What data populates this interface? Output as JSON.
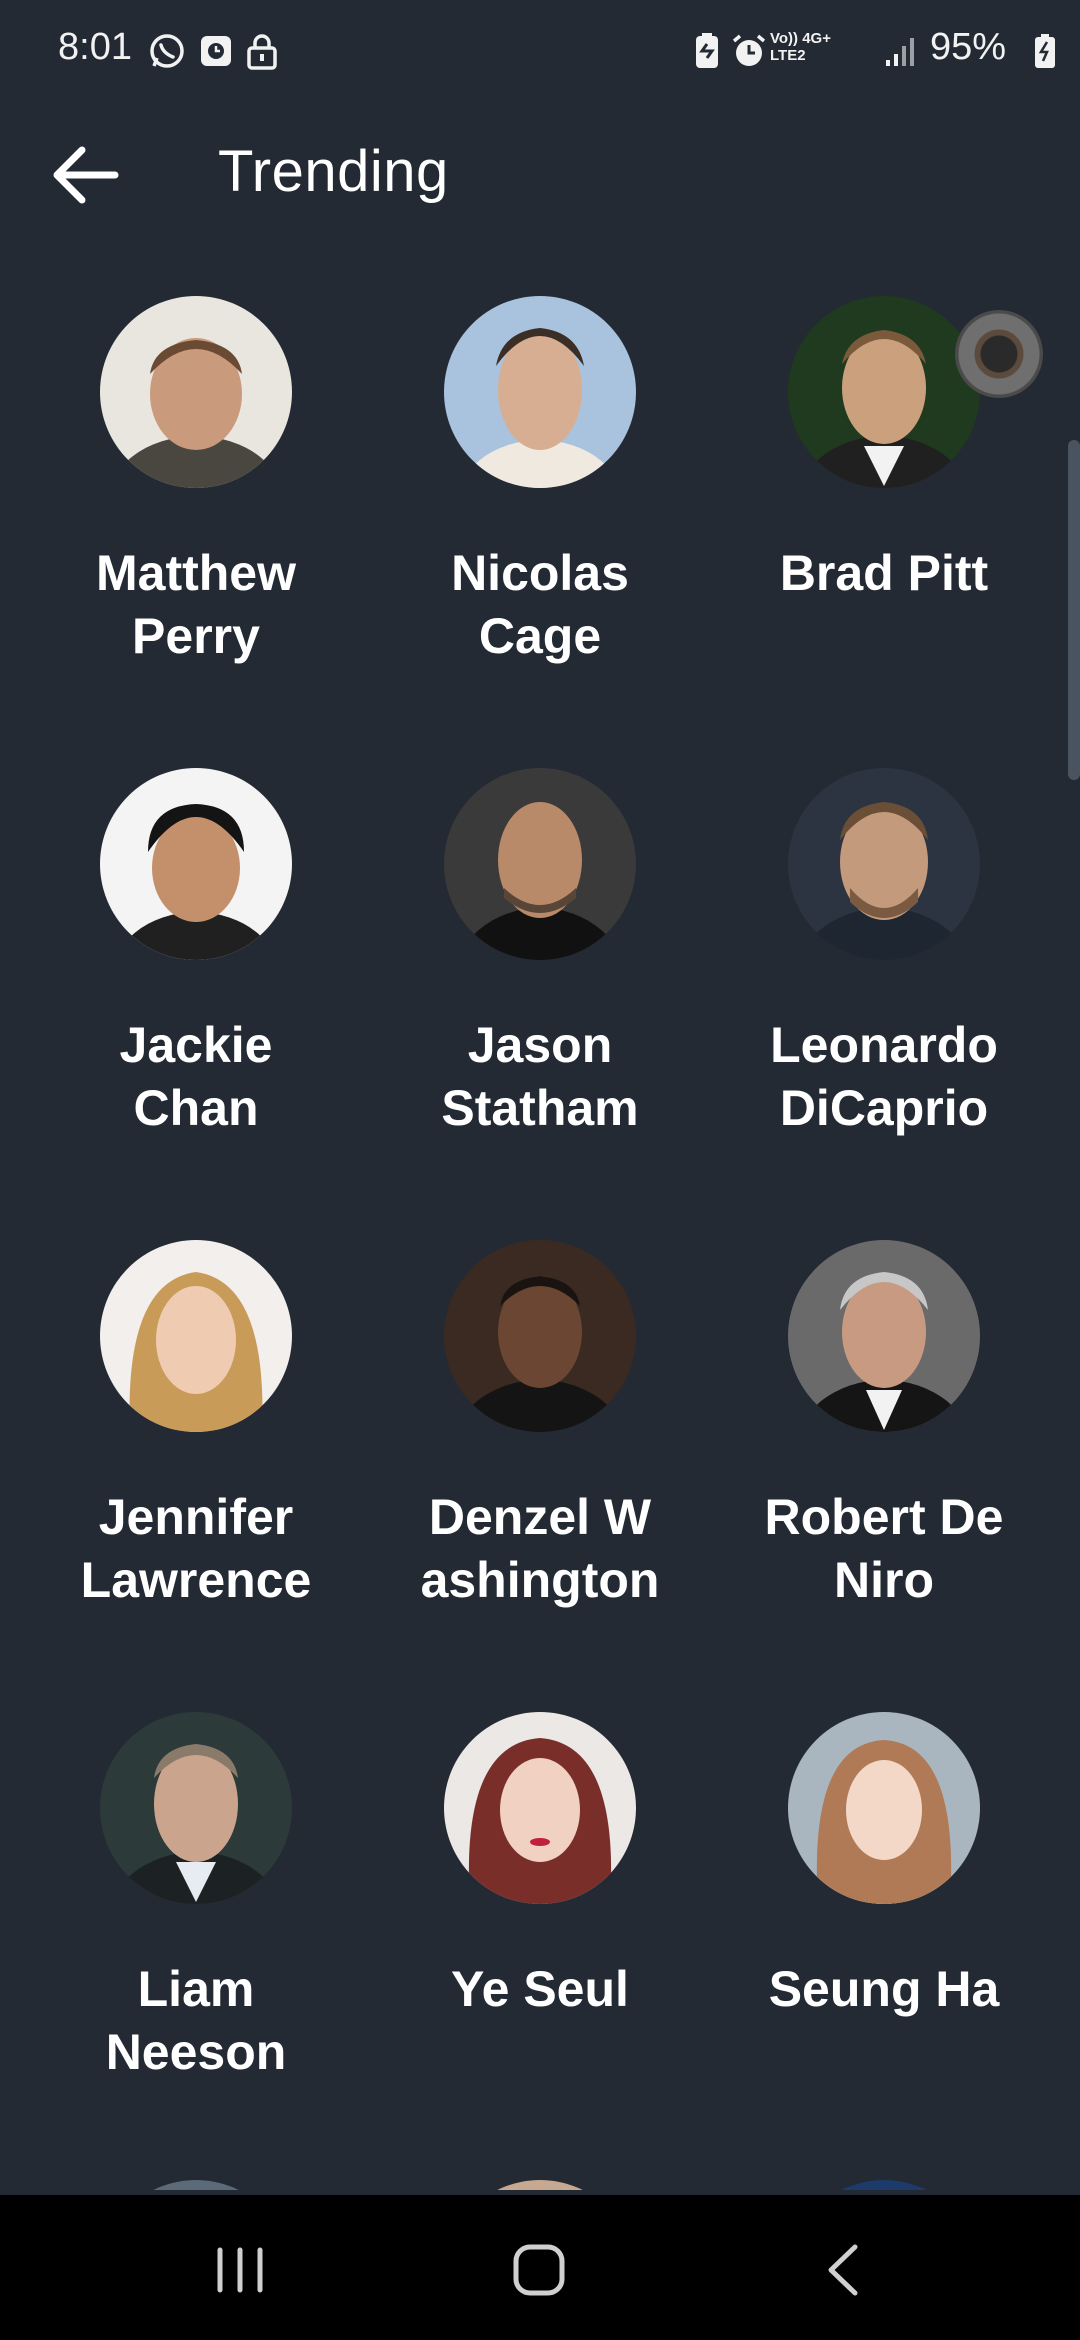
{
  "status_bar": {
    "time": "8:01",
    "battery": "95%",
    "network_top": "Vo)) 4G+",
    "network_bottom": "LTE2"
  },
  "app_bar": {
    "title": "Trending"
  },
  "people": [
    {
      "name": "Matthew\nPerry",
      "avatar": "matthew-perry-avatar"
    },
    {
      "name": "Nicolas\nCage",
      "avatar": "nicolas-cage-avatar"
    },
    {
      "name": "Brad Pitt",
      "avatar": "brad-pitt-avatar"
    },
    {
      "name": "Jackie\nChan",
      "avatar": "jackie-chan-avatar"
    },
    {
      "name": "Jason\nStatham",
      "avatar": "jason-statham-avatar"
    },
    {
      "name": "Leonardo\nDiCaprio",
      "avatar": "leonardo-dicaprio-avatar"
    },
    {
      "name": "Jennifer\nLawrence",
      "avatar": "jennifer-lawrence-avatar"
    },
    {
      "name": "Denzel W\nashington",
      "avatar": "denzel-washington-avatar"
    },
    {
      "name": "Robert De\nNiro",
      "avatar": "robert-de-niro-avatar"
    },
    {
      "name": "Liam\nNeeson",
      "avatar": "liam-neeson-avatar"
    },
    {
      "name": "Ye Seul",
      "avatar": "ye-seul-avatar"
    },
    {
      "name": "Seung Ha",
      "avatar": "seung-ha-avatar"
    }
  ],
  "icons": {
    "back": "arrow-back-icon",
    "whatsapp": "whatsapp-icon",
    "lock": "lock-icon",
    "alarm": "alarm-icon",
    "signal": "signal-icon",
    "battery": "battery-icon",
    "nav_recents": "recents-icon",
    "nav_home": "home-icon",
    "nav_back": "nav-back-icon"
  },
  "colors": {
    "background": "#232a33",
    "text": "#ffffff",
    "nav_bar": "#000000"
  }
}
